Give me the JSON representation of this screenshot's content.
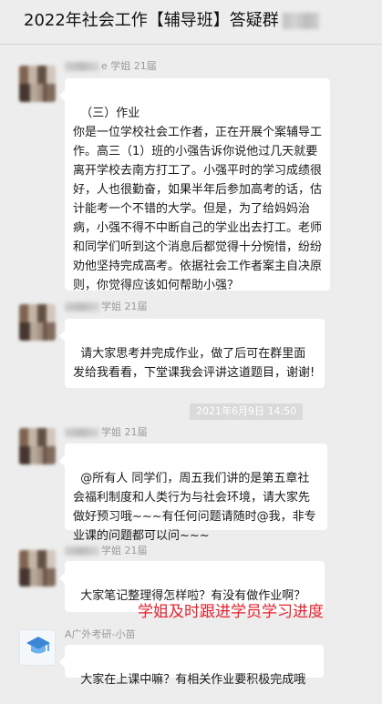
{
  "header": {
    "title": "2022年社会工作【辅导班】答疑群"
  },
  "messages": [
    {
      "sender_visible": "e 学姐 21届",
      "text": "（三）作业\n你是一位学校社会工作者，正在开展个案辅导工作。高三（1）班的小强告诉你说他过几天就要离开学校去南方打工了。小强平时的学习成绩很好，人也很勤奋，如果半年后参加高考的话，估计能考一个不错的大学。但是，为了给妈妈治病，小强不得不中断自己的学业出去打工。老师和同学们听到这个消息后都觉得十分惋惜，纷纷劝他坚持完成高考。依据社会工作者案主自决原则，你觉得应该如何帮助小强？"
    },
    {
      "sender_visible": "学姐 21届",
      "text": "请大家思考并完成作业，做了后可在群里面发给我看看，下堂课我会评讲这道题目，谢谢!"
    },
    {
      "sender_visible": "学姐 21届",
      "text": "@所有人 同学们，周五我们讲的是第五章社会福利制度和人类行为与社会环境，请大家先做好预习哦~~~有任何问题请随时@我，非专业课的问题都可以问~~~"
    },
    {
      "sender_visible": "学姐 21届",
      "text": "大家笔记整理得怎样啦？有没有做作业啊？"
    },
    {
      "sender_visible": "A广外考研-小苗",
      "text": "大家在上课中嘛？有相关作业要积极完成哦"
    }
  ],
  "timestamp": "2021年6月9日  14:50",
  "annotation": "学姐及时跟进学员学习进度",
  "icons": {
    "emoji": "smiling-face-icon",
    "logo": "graduation-cap-icon"
  },
  "colors": {
    "background": "#ededed",
    "bubble": "#ffffff",
    "annotation": "#e8232f"
  }
}
